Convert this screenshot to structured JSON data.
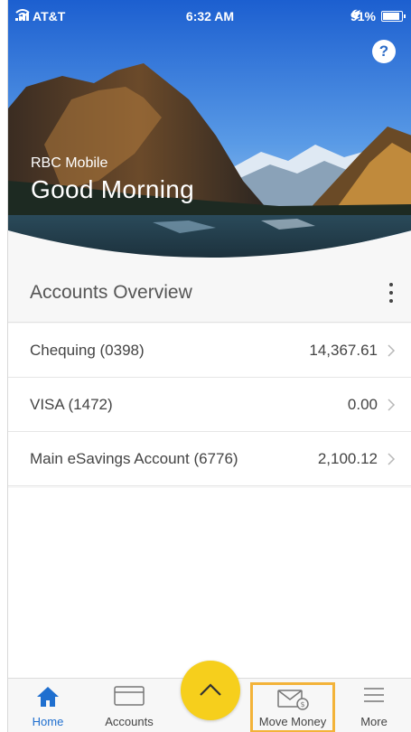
{
  "status_bar": {
    "carrier": "AT&T",
    "time": "6:32 AM",
    "battery": "91%",
    "battery_level": 0.91
  },
  "hero": {
    "app_name": "RBC Mobile",
    "greeting": "Good Morning",
    "help_label": "?"
  },
  "overview": {
    "title": "Accounts Overview",
    "menu_icon": "kebab-menu-icon"
  },
  "accounts": [
    {
      "name": "Chequing (0398)",
      "balance": "14,367.61"
    },
    {
      "name": "VISA (1472)",
      "balance": "0.00"
    },
    {
      "name": "Main eSavings Account (6776)",
      "balance": "2,100.12"
    }
  ],
  "tabbar": {
    "home": "Home",
    "accounts": "Accounts",
    "move_money": "Move Money",
    "more": "More",
    "fab_icon": "chevron-up-icon"
  },
  "colors": {
    "accent_blue": "#1f6fcf",
    "fab_yellow": "#f6cf1c",
    "highlight_orange": "#f3b339"
  }
}
